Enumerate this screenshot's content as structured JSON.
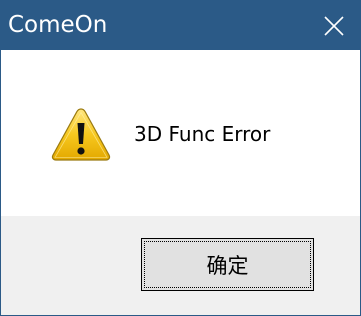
{
  "window": {
    "title": "ComeOn",
    "title_bar_color": "#2b5a87"
  },
  "titlebar": {
    "close_icon": "close-icon"
  },
  "content": {
    "icon": "warning-icon",
    "message": "3D Func Error"
  },
  "footer": {
    "ok_label": "确定"
  }
}
